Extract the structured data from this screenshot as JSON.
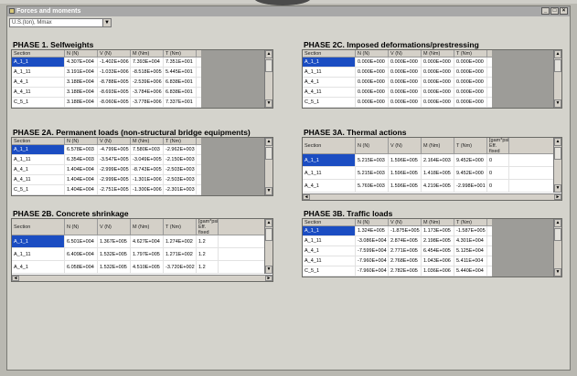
{
  "window": {
    "title": "Forces and moments",
    "min": "_",
    "max": "□",
    "close": "×"
  },
  "units": {
    "selected": "U.S.(ton), Mmax"
  },
  "headers_std": {
    "section": "Section",
    "n": "N (N)",
    "v": "V (N)",
    "m": "M (Nm)",
    "t": "T (Nm)"
  },
  "headers_extra": {
    "extra": "[gam*psi] Eff. fixed"
  },
  "panels": {
    "p1": {
      "title": "PHASE 1. Selfweights",
      "rows": [
        [
          "A_1_1",
          "4.307E+004",
          "-1.402E+006",
          "7.393E+004",
          "7.351E+001"
        ],
        [
          "A_1_11",
          "3.191E+004",
          "-1.033E+006",
          "-8.518E+005",
          "5.445E+001"
        ],
        [
          "A_4_1",
          "3.188E+004",
          "-8.788E+005",
          "-2.539E+006",
          "6.838E+001"
        ],
        [
          "A_4_11",
          "3.188E+004",
          "-8.693E+005",
          "-3.784E+006",
          "6.838E+001"
        ],
        [
          "C_5_1",
          "3.188E+004",
          "-8.060E+005",
          "-3.778E+006",
          "7.337E+001"
        ]
      ]
    },
    "p2a": {
      "title": "PHASE 2A. Permanent loads (non-structural bridge equipments)",
      "rows": [
        [
          "A_1_1",
          "6.578E+003",
          "-4.799E+005",
          "7.580E+003",
          "-2.962E+003"
        ],
        [
          "A_1_11",
          "6.354E+003",
          "-3.547E+005",
          "-3.049E+005",
          "-2.150E+003"
        ],
        [
          "A_4_1",
          "1.404E+004",
          "-2.999E+005",
          "-8.743E+005",
          "-2.503E+003"
        ],
        [
          "A_4_11",
          "1.404E+004",
          "-2.999E+005",
          "-1.301E+006",
          "-2.503E+003"
        ],
        [
          "C_5_1",
          "1.404E+004",
          "-2.751E+005",
          "-1.300E+006",
          "-2.301E+003"
        ]
      ]
    },
    "p2b": {
      "title": "PHASE 2B. Concrete shrinkage",
      "rows": [
        [
          "A_1_1",
          "6.501E+004",
          "1.367E+005",
          "4.627E+004",
          "1.274E+002",
          "1.2"
        ],
        [
          "A_1_11",
          "6.409E+004",
          "1.532E+005",
          "1.797E+005",
          "1.271E+002",
          "1.2"
        ],
        [
          "A_4_1",
          "6.058E+004",
          "1.532E+005",
          "4.510E+005",
          "-3.720E+002",
          "1.2"
        ]
      ]
    },
    "p2c": {
      "title": "PHASE 2C. Imposed deformations/prestressing",
      "rows": [
        [
          "A_1_1",
          "0.000E+000",
          "0.000E+000",
          "0.000E+000",
          "0.000E+000"
        ],
        [
          "A_1_11",
          "0.000E+000",
          "0.000E+000",
          "0.000E+000",
          "0.000E+000"
        ],
        [
          "A_4_1",
          "0.000E+000",
          "0.000E+000",
          "0.000E+000",
          "0.000E+000"
        ],
        [
          "A_4_11",
          "0.000E+000",
          "0.000E+000",
          "0.000E+000",
          "0.000E+000"
        ],
        [
          "C_5_1",
          "0.000E+000",
          "0.000E+000",
          "0.000E+000",
          "0.000E+000"
        ]
      ]
    },
    "p3a": {
      "title": "PHASE 3A. Thermal actions",
      "rows": [
        [
          "A_1_1",
          "5.215E+003",
          "1.596E+005",
          "2.164E+003",
          "9.452E+000",
          "0"
        ],
        [
          "A_1_11",
          "5.215E+003",
          "1.596E+005",
          "1.418E+005",
          "9.452E+000",
          "0"
        ],
        [
          "A_4_1",
          "5.769E+003",
          "1.596E+005",
          "4.219E+005",
          "-2.998E+001",
          "0"
        ]
      ]
    },
    "p3b": {
      "title": "PHASE 3B. Traffic loads",
      "rows": [
        [
          "A_1_1",
          "1.324E+005",
          "-1.875E+005",
          "1.173E+005",
          "-1.587E+005"
        ],
        [
          "A_1_11",
          "-3.086E+004",
          "2.874E+005",
          "2.198E+005",
          "4.301E+004"
        ],
        [
          "A_4_1",
          "-7.599E+004",
          "2.771E+005",
          "6.454E+005",
          "5.125E+004"
        ],
        [
          "A_4_11",
          "-7.960E+004",
          "2.768E+005",
          "1.043E+006",
          "5.411E+004"
        ],
        [
          "C_5_1",
          "-7.960E+004",
          "2.782E+005",
          "1.036E+006",
          "5.440E+004"
        ]
      ]
    }
  },
  "icons": {
    "up": "▲",
    "down": "▼",
    "left": "◄",
    "right": "►",
    "dropdown": "▼"
  }
}
